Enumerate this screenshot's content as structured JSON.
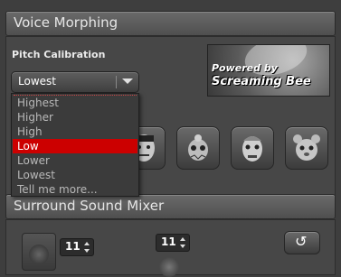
{
  "voice_morphing": {
    "title": "Voice Morphing",
    "pitch_label": "Pitch Calibration",
    "selected": "Lowest",
    "options": [
      "Highest",
      "Higher",
      "High",
      "Low",
      "Lower",
      "Lowest",
      "Tell me more..."
    ],
    "highlighted_option": "Low",
    "logo": {
      "line1": "Powered by",
      "line2": "Screaming Bee"
    },
    "voice_icons": [
      "frankenstein-face-icon",
      "alien-face-icon",
      "zombie-face-icon",
      "chipmunk-face-icon"
    ]
  },
  "surround": {
    "title": "Surround Sound Mixer",
    "left_spin": "11",
    "center_spin": "11",
    "reset_glyph": "↺"
  },
  "colors": {
    "highlight": "#cc0000",
    "panel": "#474747",
    "background": "#3e3e3e"
  }
}
